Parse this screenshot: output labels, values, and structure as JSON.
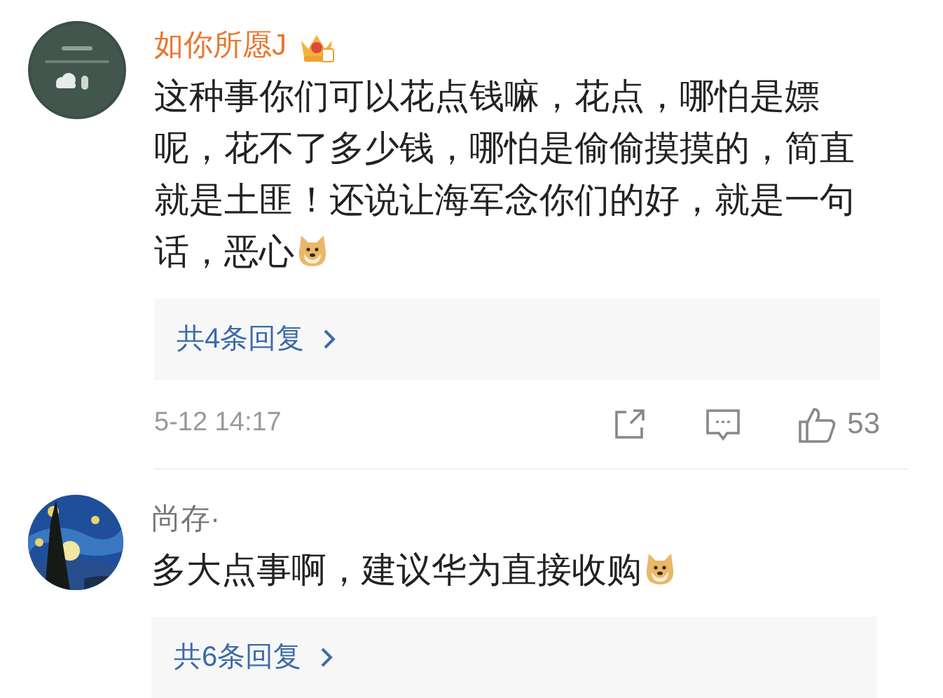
{
  "comments": [
    {
      "name": "如你所愿J",
      "vip": true,
      "text": "这种事你们可以花点钱嘛，花点，哪怕是嫖呢，花不了多少钱，哪怕是偷偷摸摸的，简直就是土匪！还说让海军念你们的好，就是一句话，恶心",
      "emoji": true,
      "replies": "共4条回复",
      "time": "5-12 14:17",
      "likes": "53"
    },
    {
      "name": "尚存·",
      "vip": false,
      "text": "多大点事啊，建议华为直接收购",
      "emoji": true,
      "replies": "共6条回复"
    }
  ]
}
